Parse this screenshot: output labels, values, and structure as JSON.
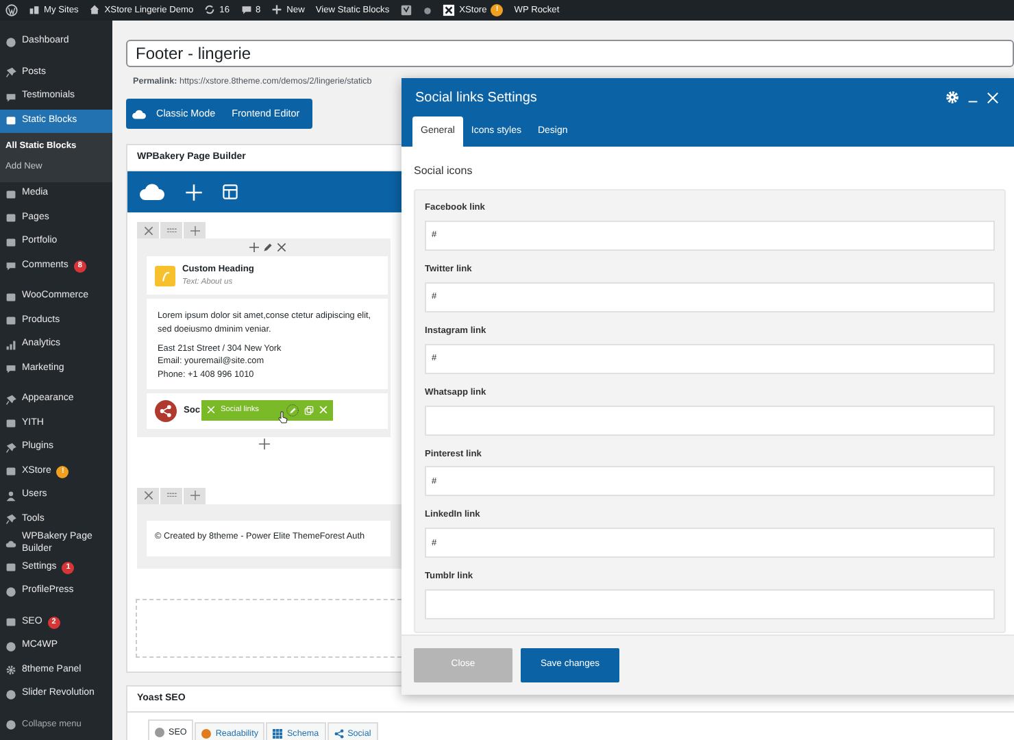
{
  "admin_bar": {
    "items": [
      {
        "kind": "wp-logo"
      },
      {
        "kind": "sites",
        "label": "My Sites"
      },
      {
        "kind": "home",
        "label": "XStore Lingerie Demo"
      },
      {
        "kind": "updates",
        "label": "16"
      },
      {
        "kind": "comments",
        "label": "8"
      },
      {
        "kind": "new",
        "label": "New"
      },
      {
        "kind": "plain",
        "label": "View Static Blocks"
      },
      {
        "kind": "yoast"
      },
      {
        "kind": "dot"
      },
      {
        "kind": "xstore",
        "label": "XStore",
        "badge": "!"
      },
      {
        "kind": "plain",
        "label": "WP Rocket"
      }
    ]
  },
  "sidebar": {
    "groups": [
      [
        {
          "label": "Dashboard",
          "selected": false
        }
      ],
      [
        {
          "label": "Posts",
          "selected": false
        },
        {
          "label": "Testimonials",
          "selected": false
        },
        {
          "label": "Static Blocks",
          "selected": true,
          "children": [
            {
              "label": "All Static Blocks",
              "selected": true
            },
            {
              "label": "Add New",
              "selected": false
            }
          ]
        },
        {
          "label": "Media",
          "selected": false
        },
        {
          "label": "Pages",
          "selected": false
        },
        {
          "label": "Portfolio",
          "selected": false
        },
        {
          "label": "Comments",
          "selected": false,
          "badge": {
            "text": "8",
            "color": "#d63638"
          }
        }
      ],
      [
        {
          "label": "WooCommerce",
          "selected": false
        },
        {
          "label": "Products",
          "selected": false
        },
        {
          "label": "Analytics",
          "selected": false
        },
        {
          "label": "Marketing",
          "selected": false
        }
      ],
      [
        {
          "label": "Appearance",
          "selected": false
        },
        {
          "label": "YITH",
          "selected": false
        },
        {
          "label": "Plugins",
          "selected": false
        },
        {
          "label": "XStore",
          "selected": false,
          "badge": {
            "text": "!",
            "color": "#f0a020"
          }
        },
        {
          "label": "Users",
          "selected": false
        },
        {
          "label": "Tools",
          "selected": false
        },
        {
          "label": "WPBakery Page Builder",
          "selected": false
        },
        {
          "label": "Settings",
          "selected": false,
          "badge": {
            "text": "1",
            "color": "#d63638"
          }
        },
        {
          "label": "ProfilePress",
          "selected": false
        }
      ],
      [
        {
          "label": "SEO",
          "selected": false,
          "badge": {
            "text": "2",
            "color": "#d63638"
          }
        },
        {
          "label": "MC4WP",
          "selected": false
        },
        {
          "label": "8theme Panel",
          "selected": false
        },
        {
          "label": "Slider Revolution",
          "selected": false
        }
      ]
    ],
    "collapse": "Collapse menu"
  },
  "title": {
    "value": "Footer - lingerie"
  },
  "permalink": {
    "label": "Permalink:",
    "url": "https://xstore.8theme.com/demos/2/lingerie/staticb"
  },
  "editor_buttons": [
    "Classic Mode",
    "Frontend Editor"
  ],
  "page_builder": {
    "title": "WPBakery Page Builder",
    "rows": [
      {
        "elements": [
          {
            "kind": "heading",
            "title": "Custom Heading",
            "subtitle": "Text: About us"
          },
          {
            "kind": "text",
            "paragraphs": [
              [
                "Lorem ipsum dolor sit amet,conse ctetur adipiscing elit, sed doeiusmo dminim veniar."
              ],
              [
                "East 21st Street / 304 New York",
                "Email: youremail@site.com",
                "Phone: +1 408 996 1010"
              ]
            ]
          },
          {
            "kind": "social",
            "title": "Soc",
            "toolbar": "Social links"
          }
        ]
      },
      {
        "elements": [
          {
            "kind": "plain",
            "title": "© Created by 8theme - Power Elite ThemeForest Auth"
          }
        ]
      }
    ]
  },
  "yoast": {
    "title": "Yoast SEO",
    "tabs": [
      {
        "label": "SEO",
        "kind": "dot",
        "color": "#9a9a9a",
        "selected": true
      },
      {
        "label": "Readability",
        "kind": "dot",
        "color": "#e07b1f",
        "selected": false
      },
      {
        "label": "Schema",
        "kind": "grid",
        "selected": false
      },
      {
        "label": "Social",
        "kind": "share",
        "selected": false
      }
    ]
  },
  "modal": {
    "title": "Social links Settings",
    "tabs": [
      {
        "label": "General",
        "selected": true
      },
      {
        "label": "Icons styles",
        "selected": false
      },
      {
        "label": "Design",
        "selected": false
      }
    ],
    "section": "Social icons",
    "fields": [
      {
        "label": "Facebook link",
        "value": "#"
      },
      {
        "label": "Twitter link",
        "value": "#"
      },
      {
        "label": "Instagram link",
        "value": "#"
      },
      {
        "label": "Whatsapp link"
      },
      {
        "label": "Pinterest link",
        "value": "#"
      },
      {
        "label": "LinkedIn link",
        "value": "#"
      },
      {
        "label": "Tumblr link"
      }
    ],
    "buttons": [
      {
        "label": "Close",
        "disabled": true
      },
      {
        "label": "Save changes",
        "disabled": false
      }
    ]
  }
}
